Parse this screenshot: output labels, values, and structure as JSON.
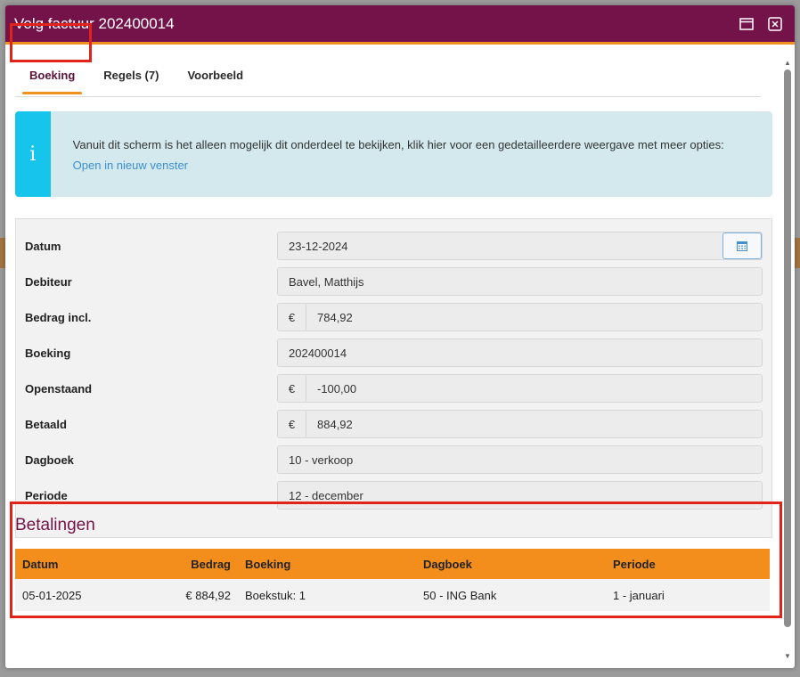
{
  "modal": {
    "title": "Volg factuur 202400014"
  },
  "tabs": [
    {
      "label": "Boeking"
    },
    {
      "label": "Regels (7)"
    },
    {
      "label": "Voorbeeld"
    }
  ],
  "info": {
    "icon": "info-icon",
    "text": "Vanuit dit scherm is het alleen mogelijk dit onderdeel te bekijken, klik hier voor een gedetailleerdere weergave met meer opties:",
    "link": "Open in nieuw venster"
  },
  "form": {
    "currency": "€",
    "datum": {
      "label": "Datum",
      "value": "23-12-2024"
    },
    "debiteur": {
      "label": "Debiteur",
      "value": "Bavel, Matthijs"
    },
    "bedrag": {
      "label": "Bedrag incl.",
      "value": "784,92"
    },
    "boeking": {
      "label": "Boeking",
      "value": "202400014"
    },
    "openstaand": {
      "label": "Openstaand",
      "value": "-100,00"
    },
    "betaald": {
      "label": "Betaald",
      "value": "884,92"
    },
    "dagboek": {
      "label": "Dagboek",
      "value": "10 - verkoop"
    },
    "periode": {
      "label": "Periode",
      "value": "12 - december"
    }
  },
  "payments": {
    "title": "Betalingen",
    "columns": [
      "Datum",
      "Bedrag",
      "Boeking",
      "Dagboek",
      "Periode"
    ],
    "rows": [
      [
        "05-01-2025",
        "€ 884,92",
        "Boekstuk: 1",
        "50 - ING Bank",
        "1 - januari"
      ]
    ]
  },
  "colors": {
    "header": "#74134a",
    "accent": "#f0901e",
    "info": "#16c4ec",
    "highlight": "#e2231a"
  }
}
